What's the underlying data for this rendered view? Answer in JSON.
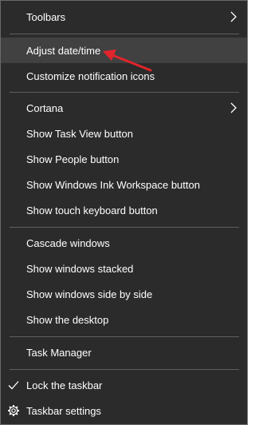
{
  "menu": {
    "toolbars": "Toolbars",
    "adjust_datetime": "Adjust date/time",
    "customize_notification_icons": "Customize notification icons",
    "cortana": "Cortana",
    "show_task_view": "Show Task View button",
    "show_people": "Show People button",
    "show_ink_workspace": "Show Windows Ink Workspace button",
    "show_touch_keyboard": "Show touch keyboard button",
    "cascade_windows": "Cascade windows",
    "show_windows_stacked": "Show windows stacked",
    "show_windows_side_by_side": "Show windows side by side",
    "show_desktop": "Show the desktop",
    "task_manager": "Task Manager",
    "lock_taskbar": "Lock the taskbar",
    "taskbar_settings": "Taskbar settings"
  },
  "state": {
    "lock_taskbar_checked": true,
    "hovered_item": "adjust_datetime"
  },
  "colors": {
    "menu_background": "#2b2b2b",
    "hover_background": "#414141",
    "separator": "#5f5f5f",
    "text": "#ffffff",
    "annotation_arrow": "#e0252b"
  },
  "icons": {
    "submenu": "chevron-right-icon",
    "checked": "checkmark-icon",
    "settings": "gear-icon",
    "annotation": "red-arrow-icon"
  }
}
